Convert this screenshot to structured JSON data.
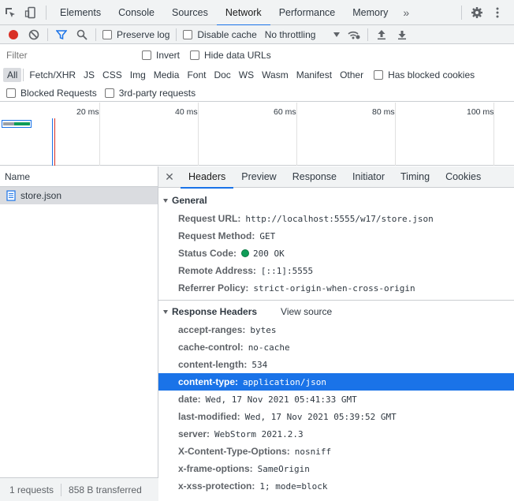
{
  "devtools": {
    "tabs": [
      {
        "label": "Elements"
      },
      {
        "label": "Console"
      },
      {
        "label": "Sources"
      },
      {
        "label": "Network",
        "active": true
      },
      {
        "label": "Performance"
      },
      {
        "label": "Memory"
      }
    ],
    "more": "»"
  },
  "toolbar": {
    "preserve_log": "Preserve log",
    "disable_cache": "Disable cache",
    "throttling": "No throttling"
  },
  "filter": {
    "placeholder": "Filter",
    "invert": "Invert",
    "hide_data_urls": "Hide data URLs"
  },
  "types": [
    "All",
    "Fetch/XHR",
    "JS",
    "CSS",
    "Img",
    "Media",
    "Font",
    "Doc",
    "WS",
    "Wasm",
    "Manifest",
    "Other"
  ],
  "has_blocked_cookies": "Has blocked cookies",
  "blocked_requests": "Blocked Requests",
  "third_party": "3rd-party requests",
  "overview": {
    "ticks": [
      "20 ms",
      "40 ms",
      "60 ms",
      "80 ms",
      "100 ms"
    ]
  },
  "requests": {
    "column": "Name",
    "items": [
      {
        "name": "store.json"
      }
    ],
    "status": {
      "count": "1 requests",
      "transferred": "858 B transferred"
    }
  },
  "details": {
    "tabs": [
      "Headers",
      "Preview",
      "Response",
      "Initiator",
      "Timing",
      "Cookies"
    ],
    "general": {
      "title": "General",
      "request_url_k": "Request URL:",
      "request_url_v": "http://localhost:5555/w17/store.json",
      "method_k": "Request Method:",
      "method_v": "GET",
      "status_k": "Status Code:",
      "status_v": "200 OK",
      "remote_k": "Remote Address:",
      "remote_v": "[::1]:5555",
      "referrer_k": "Referrer Policy:",
      "referrer_v": "strict-origin-when-cross-origin"
    },
    "response_headers": {
      "title": "Response Headers",
      "view_source": "View source",
      "items": [
        {
          "k": "accept-ranges:",
          "v": "bytes"
        },
        {
          "k": "cache-control:",
          "v": "no-cache"
        },
        {
          "k": "content-length:",
          "v": "534"
        },
        {
          "k": "content-type:",
          "v": "application/json"
        },
        {
          "k": "date:",
          "v": "Wed, 17 Nov 2021 05:41:33 GMT"
        },
        {
          "k": "last-modified:",
          "v": "Wed, 17 Nov 2021 05:39:52 GMT"
        },
        {
          "k": "server:",
          "v": "WebStorm 2021.2.3"
        },
        {
          "k": "X-Content-Type-Options:",
          "v": "nosniff"
        },
        {
          "k": "x-frame-options:",
          "v": "SameOrigin"
        },
        {
          "k": "x-xss-protection:",
          "v": "1; mode=block"
        }
      ]
    }
  },
  "colors": {
    "accent": "#1a73e8",
    "record": "#d93025",
    "ok": "#0f9d58"
  }
}
